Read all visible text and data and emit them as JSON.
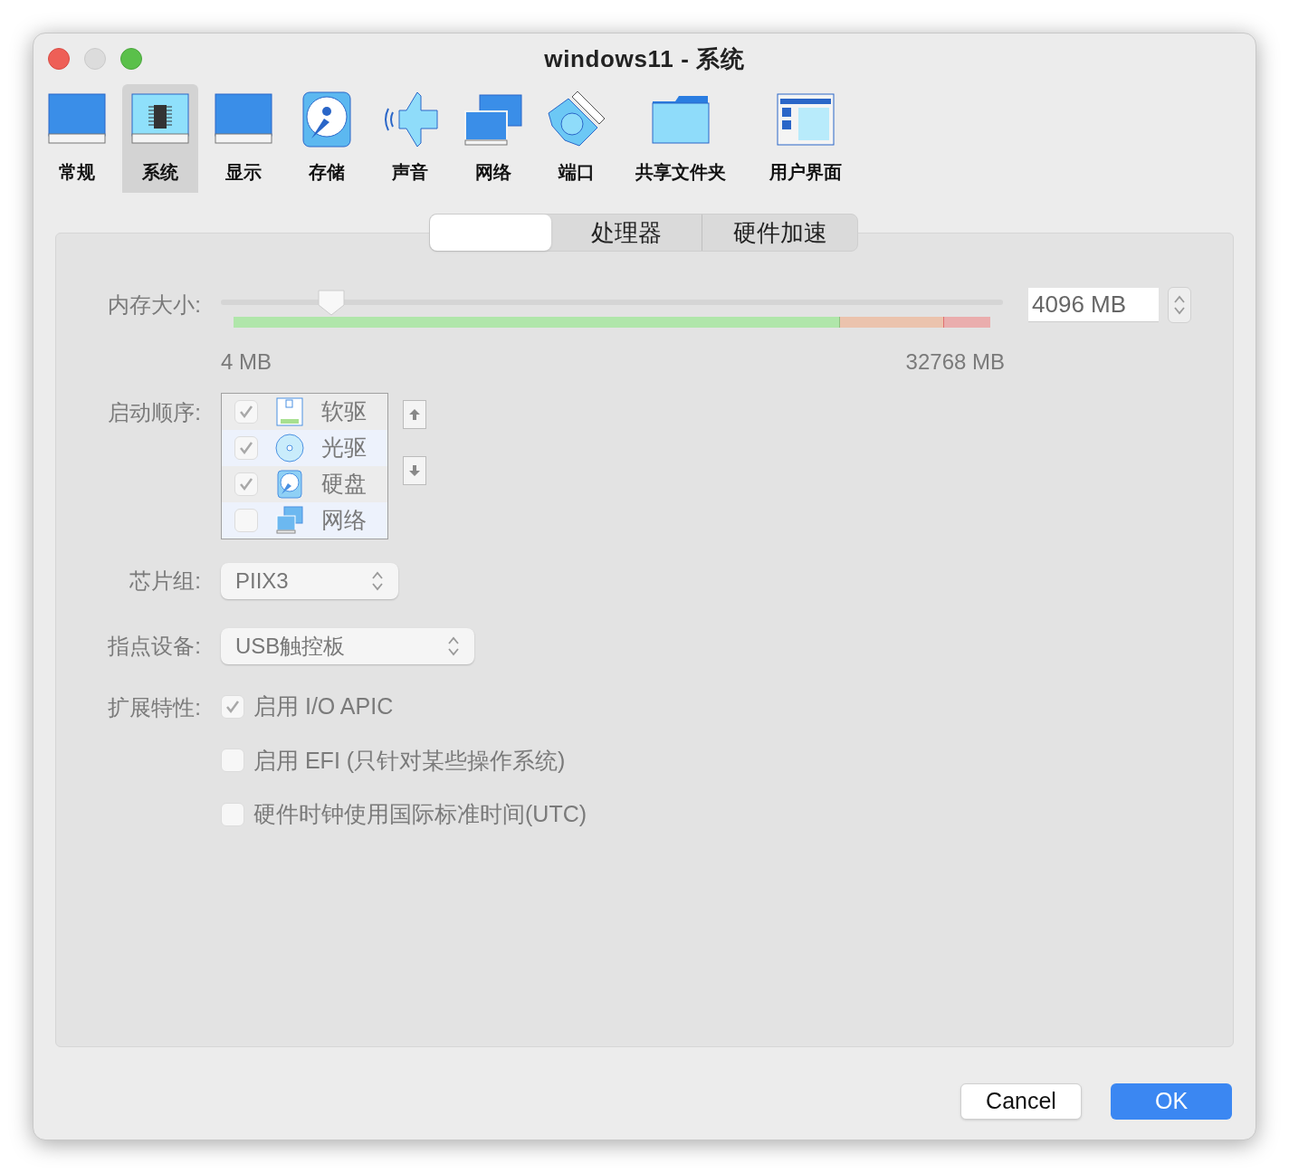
{
  "window": {
    "title": "windows11 - 系统"
  },
  "toolbar": [
    {
      "label": "常规",
      "selected": false
    },
    {
      "label": "系统",
      "selected": true
    },
    {
      "label": "显示",
      "selected": false
    },
    {
      "label": "存储",
      "selected": false
    },
    {
      "label": "声音",
      "selected": false
    },
    {
      "label": "网络",
      "selected": false
    },
    {
      "label": "端口",
      "selected": false
    },
    {
      "label": "共享文件夹",
      "selected": false
    },
    {
      "label": "用户界面",
      "selected": false
    }
  ],
  "tabs": [
    {
      "selected": true
    },
    {
      "label": "处理器",
      "selected": false
    },
    {
      "label": "硬件加速",
      "selected": false
    }
  ],
  "memory": {
    "label": "内存大小:",
    "level": 0.125,
    "value": "4096 MB",
    "min_label": "4 MB",
    "max_label": "32768 MB"
  },
  "boot_order": {
    "label": "启动顺序:",
    "items": [
      {
        "label": "软驱",
        "checked": true
      },
      {
        "label": "光驱",
        "checked": true
      },
      {
        "label": "硬盘",
        "checked": true
      },
      {
        "label": "网络",
        "checked": false
      }
    ]
  },
  "chipset": {
    "label": "芯片组:",
    "value": "PIIX3"
  },
  "pointing_device": {
    "label": "指点设备:",
    "value": "USB触控板"
  },
  "extended_features": {
    "label": "扩展特性:",
    "options": [
      {
        "label": "启用 I/O APIC",
        "checked": true
      },
      {
        "label": "启用 EFI (只针对某些操作系统)",
        "checked": false
      },
      {
        "label": "硬件时钟使用国际标准时间(UTC)",
        "checked": false
      }
    ]
  },
  "buttons": [
    {
      "label": "Cancel",
      "kind": "secondary"
    },
    {
      "label": "OK",
      "kind": "primary"
    }
  ]
}
